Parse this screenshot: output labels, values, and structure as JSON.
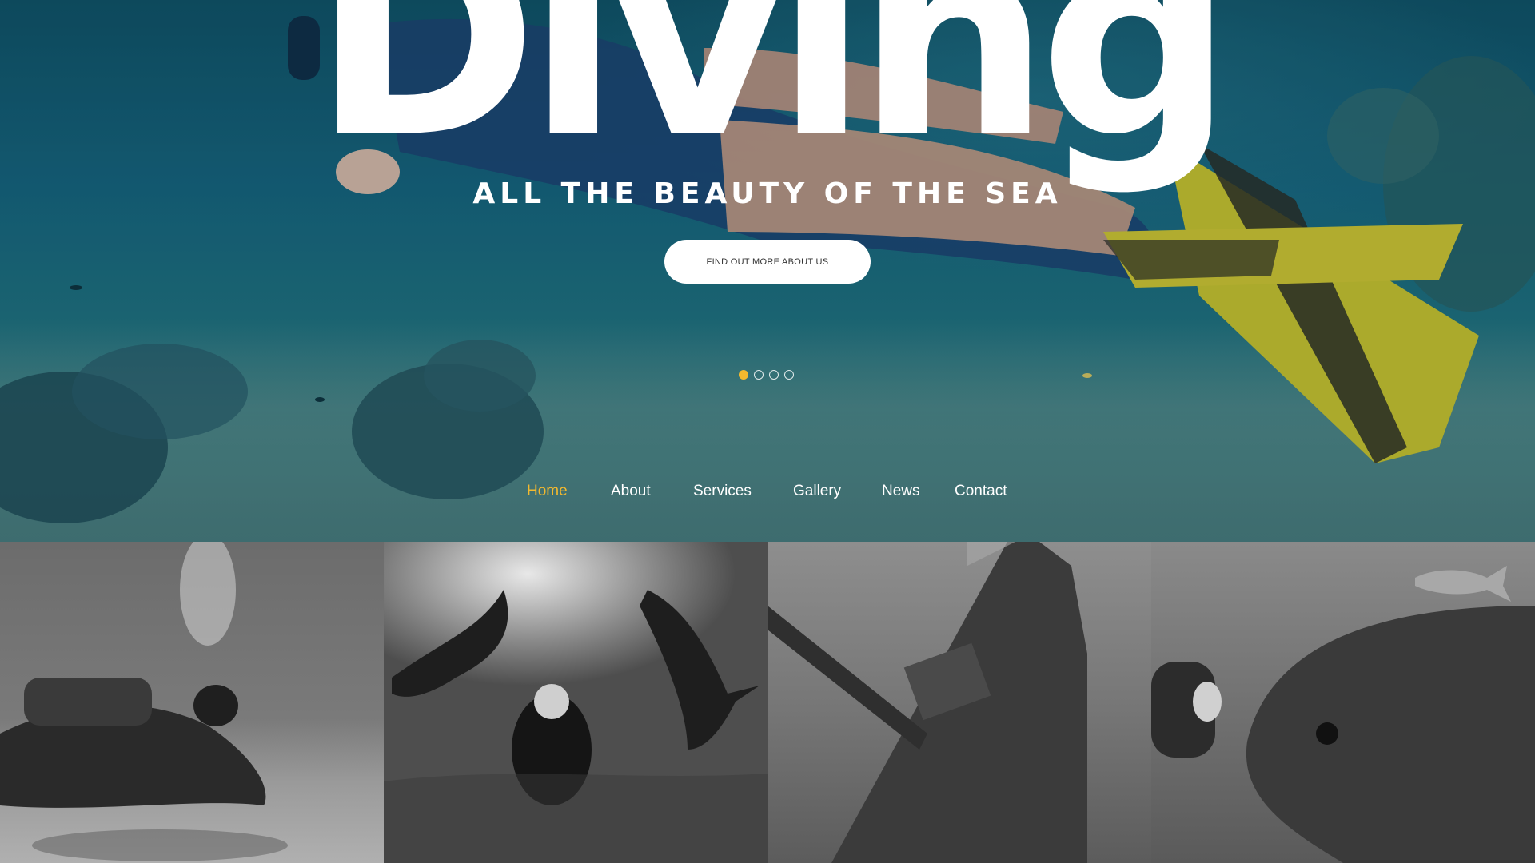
{
  "hero": {
    "title": "Diving",
    "tagline": "ALL THE BEAUTY OF THE SEA",
    "cta_label": "FIND OUT MORE ABOUT US"
  },
  "slider": {
    "total_slides": 4,
    "active_slide": 1,
    "accent_color": "#f3b92e"
  },
  "nav": {
    "items": [
      {
        "label": "Home",
        "active": true
      },
      {
        "label": "About",
        "active": false
      },
      {
        "label": "Services",
        "active": false
      },
      {
        "label": "Gallery",
        "active": false
      },
      {
        "label": "News",
        "active": false
      },
      {
        "label": "Contact",
        "active": false
      }
    ]
  },
  "gallery": {
    "tiles": [
      "diver-over-sand-photo",
      "manta-rays-photo",
      "shipwreck-photo",
      "fish-closeup-photo"
    ]
  }
}
